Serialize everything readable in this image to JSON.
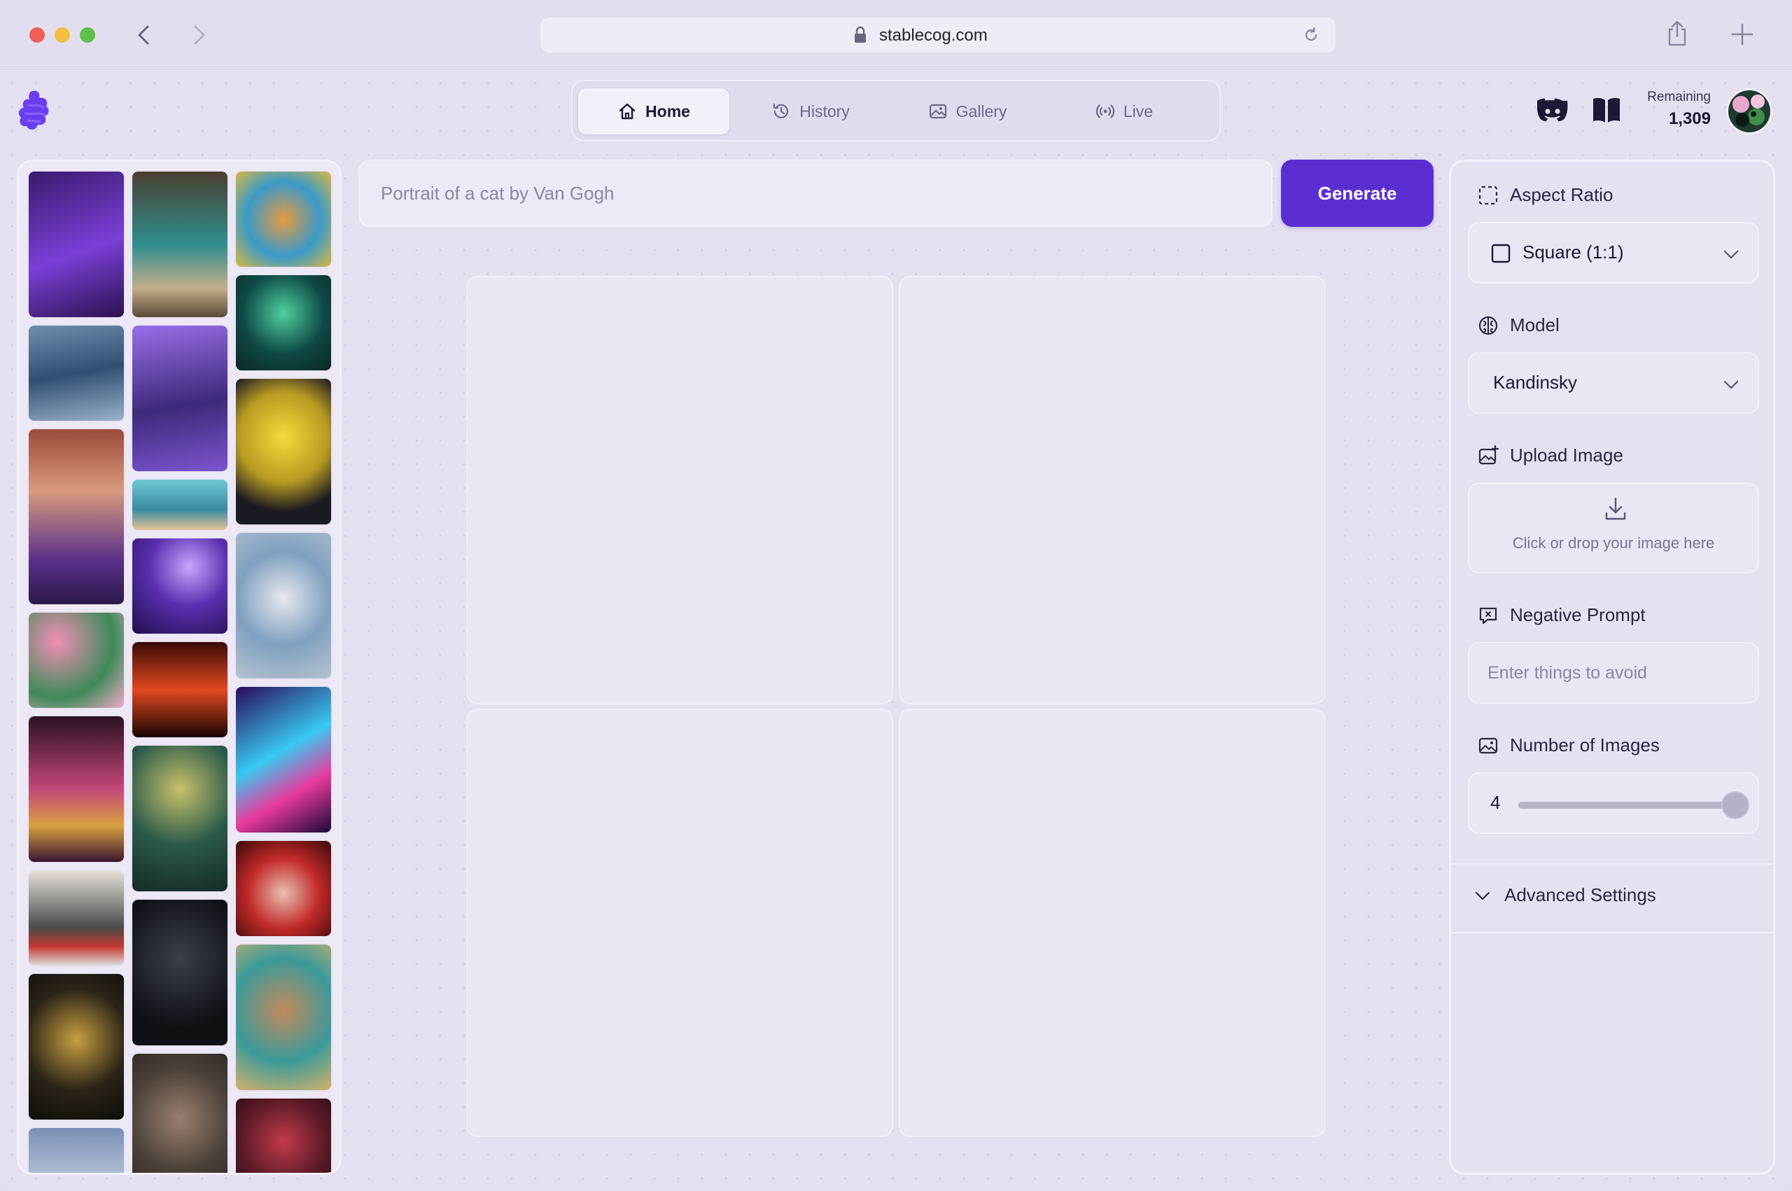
{
  "browser": {
    "url": "stablecog.com"
  },
  "nav": {
    "tabs": [
      {
        "label": "Home",
        "icon": "home-icon",
        "active": true
      },
      {
        "label": "History",
        "icon": "history-icon",
        "active": false
      },
      {
        "label": "Gallery",
        "icon": "image-icon",
        "active": false
      },
      {
        "label": "Live",
        "icon": "broadcast-icon",
        "active": false
      }
    ]
  },
  "account": {
    "remaining_label": "Remaining",
    "remaining_value": "1,309"
  },
  "prompt": {
    "placeholder": "Portrait of a cat by Van Gogh",
    "generate_label": "Generate"
  },
  "settings": {
    "aspect_ratio": {
      "label": "Aspect Ratio",
      "value": "Square (1:1)"
    },
    "model": {
      "label": "Model",
      "value": "Kandinsky"
    },
    "upload": {
      "label": "Upload Image",
      "hint": "Click or drop your image here"
    },
    "negative_prompt": {
      "label": "Negative Prompt",
      "placeholder": "Enter things to avoid"
    },
    "num_images": {
      "label": "Number of Images",
      "value": "4",
      "fraction": 1.0
    },
    "advanced": {
      "label": "Advanced Settings"
    }
  },
  "colors": {
    "accent": "#5b2ed1",
    "background": "#e5e0f0"
  }
}
